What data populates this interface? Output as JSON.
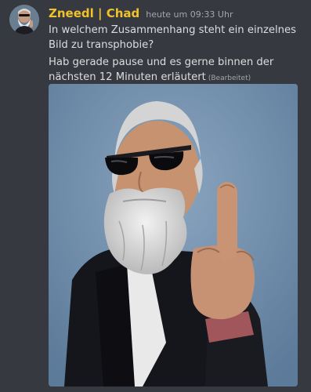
{
  "message": {
    "author": "Zneedl | Chad",
    "timestamp": "heute um 09:33 Uhr",
    "lines": [
      "In welchem Zusammenhang steht ein einzelnes Bild zu transphobie?",
      "Hab gerade pause und es gerne binnen der nächsten 12 Minuten erläutert"
    ],
    "edited_label": "(Bearbeitet)"
  },
  "colors": {
    "background": "#36393f",
    "username": "#f0c22c",
    "text": "#dcddde",
    "muted": "#a3a6aa"
  },
  "icons": {
    "avatar": "user-avatar",
    "attachment": "image-attachment"
  }
}
